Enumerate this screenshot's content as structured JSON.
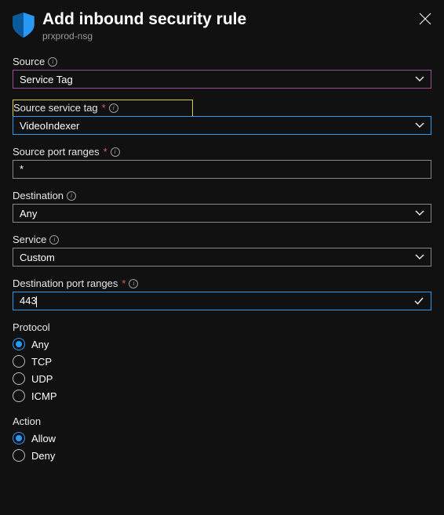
{
  "header": {
    "title": "Add inbound security rule",
    "subtitle": "prxprod-nsg"
  },
  "fields": {
    "source": {
      "label": "Source",
      "value": "Service Tag"
    },
    "sourceServiceTag": {
      "label": "Source service tag",
      "value": "VideoIndexer"
    },
    "sourcePortRanges": {
      "label": "Source port ranges",
      "value": "*"
    },
    "destination": {
      "label": "Destination",
      "value": "Any"
    },
    "service": {
      "label": "Service",
      "value": "Custom"
    },
    "destinationPortRanges": {
      "label": "Destination port ranges",
      "value": "443"
    }
  },
  "protocol": {
    "label": "Protocol",
    "options": [
      "Any",
      "TCP",
      "UDP",
      "ICMP"
    ],
    "selected": "Any"
  },
  "action": {
    "label": "Action",
    "options": [
      "Allow",
      "Deny"
    ],
    "selected": "Allow"
  }
}
